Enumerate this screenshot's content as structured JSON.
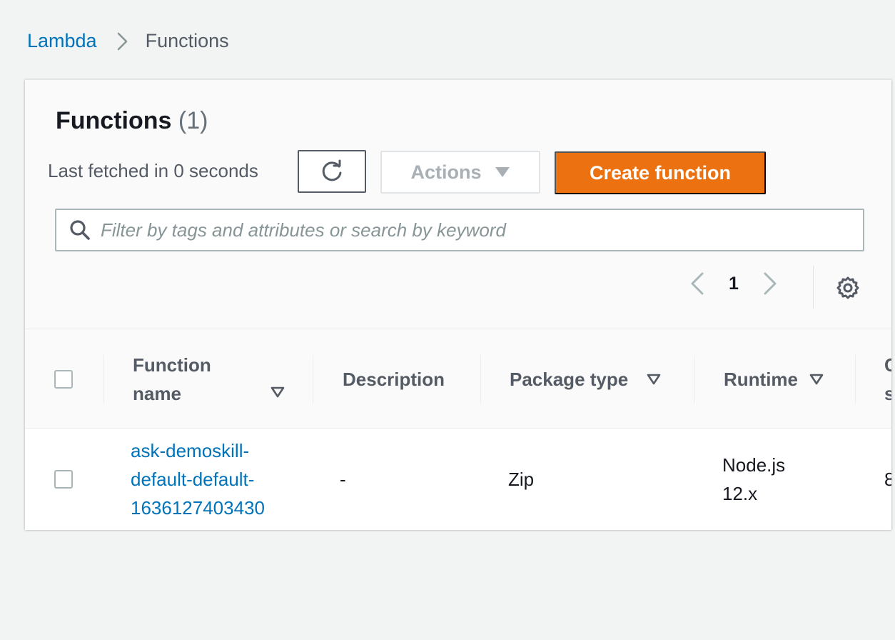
{
  "breadcrumb": {
    "root": "Lambda",
    "current": "Functions"
  },
  "header": {
    "title": "Functions",
    "count": "(1)",
    "last_fetched": "Last fetched in 0 seconds",
    "refresh_icon": "refresh-icon",
    "actions_label": "Actions",
    "create_label": "Create function"
  },
  "search": {
    "placeholder": "Filter by tags and attributes or search by keyword",
    "value": ""
  },
  "pagination": {
    "current_page": "1"
  },
  "table": {
    "columns": [
      {
        "key": "function_name",
        "line1": "Function",
        "line2": "name",
        "sortable": true
      },
      {
        "key": "description",
        "line1": "Description",
        "line2": "",
        "sortable": false
      },
      {
        "key": "package_type",
        "line1": "Package type",
        "line2": "",
        "sortable": true
      },
      {
        "key": "runtime",
        "line1": "Runtime",
        "line2": "",
        "sortable": true
      }
    ],
    "rows": [
      {
        "function_name_lines": [
          "ask-demoskill-",
          "default-default-",
          "1636127403430"
        ],
        "description": "-",
        "package_type": "Zip",
        "runtime_lines": [
          "Node.js",
          "12.x"
        ],
        "truncated_next": "8"
      }
    ],
    "truncated_header": [
      "C",
      "s"
    ]
  },
  "colors": {
    "accent_link": "#0073bb",
    "primary_button": "#ec7211",
    "background": "#f2f3f3"
  }
}
